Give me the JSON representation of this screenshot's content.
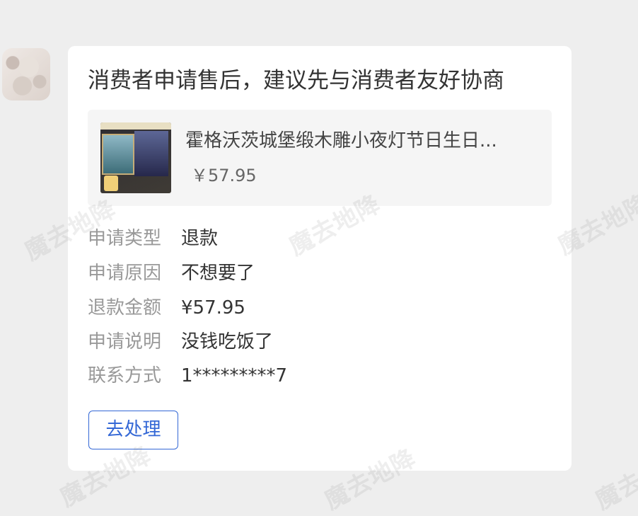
{
  "card": {
    "title": "消费者申请售后，建议先与消费者友好协商"
  },
  "product": {
    "name": "霍格沃茨城堡缎木雕小夜灯节日生日...",
    "price": "￥57.95"
  },
  "details": [
    {
      "label": "申请类型",
      "value": "退款"
    },
    {
      "label": "申请原因",
      "value": "不想要了"
    },
    {
      "label": "退款金额",
      "value": "¥57.95"
    },
    {
      "label": "申请说明",
      "value": "没钱吃饭了"
    },
    {
      "label": "联系方式",
      "value": "1*********7"
    }
  ],
  "action": {
    "label": "去处理"
  },
  "colors": {
    "accent": "#3468d6",
    "background": "#eeeeee",
    "card": "#ffffff",
    "label": "#999999",
    "text": "#333333"
  }
}
